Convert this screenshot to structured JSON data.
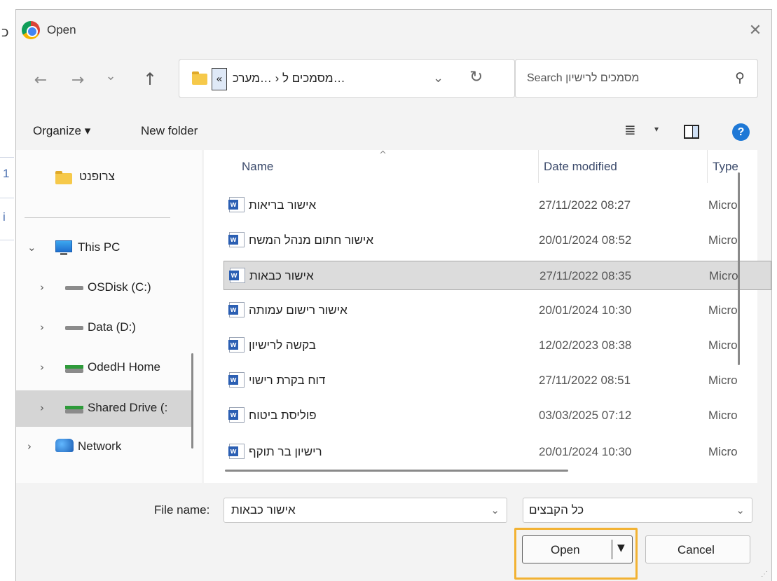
{
  "background_window": {
    "glyph_top": "כ",
    "glyph_mid": "1",
    "glyph_low": "i"
  },
  "window": {
    "title": "Open",
    "close_glyph": "✕"
  },
  "navigation": {
    "back_glyph": "←",
    "forward_glyph": "→",
    "recent_glyph": "⌄",
    "up_glyph": "↑"
  },
  "address_bar": {
    "overflow_glyph": "«",
    "crumbs": "…מסמכים ל  ‹  …מערכ",
    "dropdown_glyph": "⌄",
    "refresh_glyph": "↻"
  },
  "search": {
    "placeholder": "Search מסמכים לרישיון",
    "icon_glyph": "⚲"
  },
  "toolbar": {
    "organize_label": "Organize ▾",
    "new_folder_label": "New folder",
    "view_glyph": "≣",
    "view_dropdown_glyph": "▾",
    "help_glyph": "?"
  },
  "nav_pane": {
    "items": [
      {
        "label": "צרופנט",
        "chevron": ""
      },
      {
        "label": "This PC",
        "chevron": "⌄"
      },
      {
        "label": "OSDisk (C:)",
        "chevron": "›"
      },
      {
        "label": "Data (D:)",
        "chevron": "›"
      },
      {
        "label": "OdedH Home",
        "chevron": "›"
      },
      {
        "label": "Shared Drive (:",
        "chevron": "›"
      },
      {
        "label": "Network",
        "chevron": "›"
      }
    ]
  },
  "file_list": {
    "sort_glyph": "^",
    "columns": [
      "Name",
      "Date modified",
      "Type"
    ],
    "rows": [
      {
        "name": "אישור בריאות",
        "date": "27/11/2022 08:27",
        "type": "Micro"
      },
      {
        "name": "אישור חתום מנהל המשח",
        "date": "20/01/2024 08:52",
        "type": "Micro"
      },
      {
        "name": "אישור כבאות",
        "date": "27/11/2022 08:35",
        "type": "Micro"
      },
      {
        "name": "אישור רישום עמותה",
        "date": "20/01/2024 10:30",
        "type": "Micro"
      },
      {
        "name": "בקשה לרישיון",
        "date": "12/02/2023 08:38",
        "type": "Micro"
      },
      {
        "name": "דוח בקרת רישוי",
        "date": "27/11/2022 08:51",
        "type": "Micro"
      },
      {
        "name": "פוליסת ביטוח",
        "date": "03/03/2025 07:12",
        "type": "Micro"
      },
      {
        "name": "רישיון בר תוקף",
        "date": "20/01/2024 10:30",
        "type": "Micro"
      }
    ]
  },
  "file_name": {
    "label": "File name:",
    "value": "אישור כבאות",
    "dropdown_glyph": "⌄"
  },
  "file_type": {
    "value": "כל הקבצים",
    "dropdown_glyph": "⌄"
  },
  "buttons": {
    "open_label": "Open",
    "open_split_glyph": "▼",
    "cancel_label": "Cancel"
  },
  "accent_colors": {
    "highlight": "#f2b233",
    "help": "#1e78d6",
    "selection": "#dcdcdc"
  }
}
